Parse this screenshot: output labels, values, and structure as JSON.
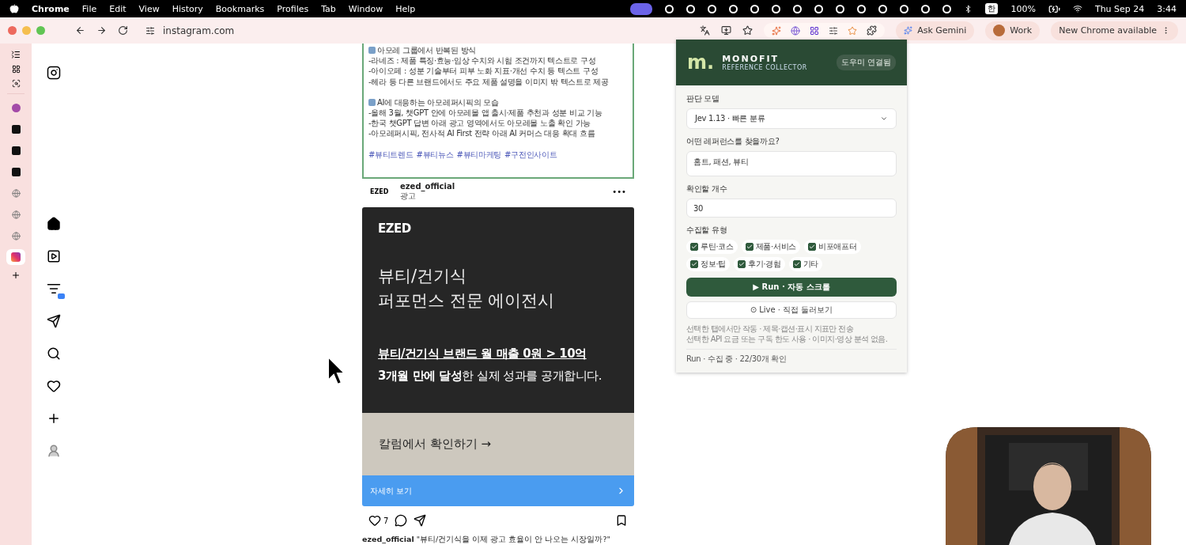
{
  "menubar": {
    "app": "Chrome",
    "menus": [
      "File",
      "Edit",
      "View",
      "History",
      "Bookmarks",
      "Profiles",
      "Tab",
      "Window",
      "Help"
    ],
    "input_source": "한",
    "battery": "100%",
    "date": "Thu Sep 24",
    "time": "3:44"
  },
  "toolbar": {
    "address": "instagram.com",
    "gemini": "Ask Gemini",
    "profile": "Work",
    "update": "New Chrome available"
  },
  "tab_sidebar": [
    {
      "kind": "site",
      "selected": false
    },
    {
      "kind": "dark",
      "selected": false
    },
    {
      "kind": "dark",
      "selected": false
    },
    {
      "kind": "dark",
      "selected": false
    },
    {
      "kind": "globe",
      "selected": false
    },
    {
      "kind": "globe",
      "selected": false
    },
    {
      "kind": "globe",
      "selected": false
    },
    {
      "kind": "instagram",
      "selected": true
    }
  ],
  "nav": [
    {
      "kind": "home",
      "selected": true
    },
    {
      "kind": "reels",
      "selected": false
    },
    {
      "kind": "feed",
      "selected": false
    },
    {
      "kind": "send",
      "selected": false
    },
    {
      "kind": "search",
      "selected": false
    },
    {
      "kind": "heart",
      "selected": false
    },
    {
      "kind": "create",
      "selected": false
    },
    {
      "kind": "profile",
      "selected": false
    }
  ],
  "post_text": [
    {
      "kind": "heading",
      "text": "아모레 그룹에서 반복된 방식"
    },
    {
      "kind": "line",
      "text": "-라네즈 : 제품 특징·효능·임상 수치와 시험 조건까지 텍스트로 구성"
    },
    {
      "kind": "line",
      "text": "-아이오페 : 성분 기술부터 피부 노화 지표·개선 수치 등 텍스트 구성"
    },
    {
      "kind": "line",
      "text": "-헤라 등 다른 브랜드에서도 주요 제품 설명을 이미지 밖 텍스트로 제공"
    },
    {
      "kind": "heading",
      "text": "AI에 대응하는 아모레퍼시픽의 모습"
    },
    {
      "kind": "line",
      "text": "-올해 3월, 챗GPT 안에 아모레몰 앱 출시·제품 추천과 성분 비교 기능"
    },
    {
      "kind": "line",
      "text": "-한국 챗GPT 답변 아래 광고 영역에서도 아모레몰 노출 확인 가능"
    },
    {
      "kind": "line",
      "text": "-아모레퍼시픽, 전사적 AI First 전략 아래 AI 커머스 대응 확대 흐름"
    }
  ],
  "hashtags": [
    "#뷰티트렌드",
    "#뷰티뉴스",
    "#뷰티마케팅",
    "#구전인사이트"
  ],
  "ad_post": {
    "avatar": "EZED",
    "account": "ezed_official",
    "label": "광고",
    "more": "•••",
    "brand": "EZED",
    "headline": [
      "뷰티/건기식",
      "퍼포먼스 전문 에이전시"
    ],
    "claim": "뷰티/건기식 브랜드 월 매출 0원 > 10억",
    "sub_bold": "3개월 만에 달성",
    "sub_rest": "한 실제 성과를 공개합니다.",
    "cta": "칼럼에서 확인하기 →",
    "link": "자세히 보기",
    "likes": "7",
    "caption_account": "ezed_official",
    "caption": "\"뷰티/건기식을 이제 광고 효율이 안 나오는 시장일까?\""
  },
  "extension": {
    "logo": "m.",
    "title": "MONOFIT",
    "subtitle": "REFERENCE COLLECTOR",
    "status": "도우미 연결됨",
    "model_label": "판단 모델",
    "model": "Jev 1.13 · 빠른 분류",
    "query_label": "어떤 레퍼런스를 찾을까요?",
    "query": "홈트, 패션, 뷰티",
    "count_label": "확인할 개수",
    "count": "30",
    "types_label": "수집할 유형",
    "types": [
      {
        "label": "루틴·코스",
        "checked": true
      },
      {
        "label": "제품·서비스",
        "checked": true
      },
      {
        "label": "비포애프터",
        "checked": true
      },
      {
        "label": "정보·팁",
        "checked": true
      },
      {
        "label": "후기·경험",
        "checked": true
      },
      {
        "label": "기타",
        "checked": true
      }
    ],
    "run": "▶ Run · 자동 스크롤",
    "live": "⊙ Live · 직접 둘러보기",
    "notes": [
      "선택한 탭에서만 작동 · 제목·캡션·표시 지표만 전송",
      "선택한 API 요금 또는 구독 한도 사용 · 이미지·영상 분석 없음."
    ],
    "status_line": "Run · 수집 중 · 22/30개 확인"
  }
}
